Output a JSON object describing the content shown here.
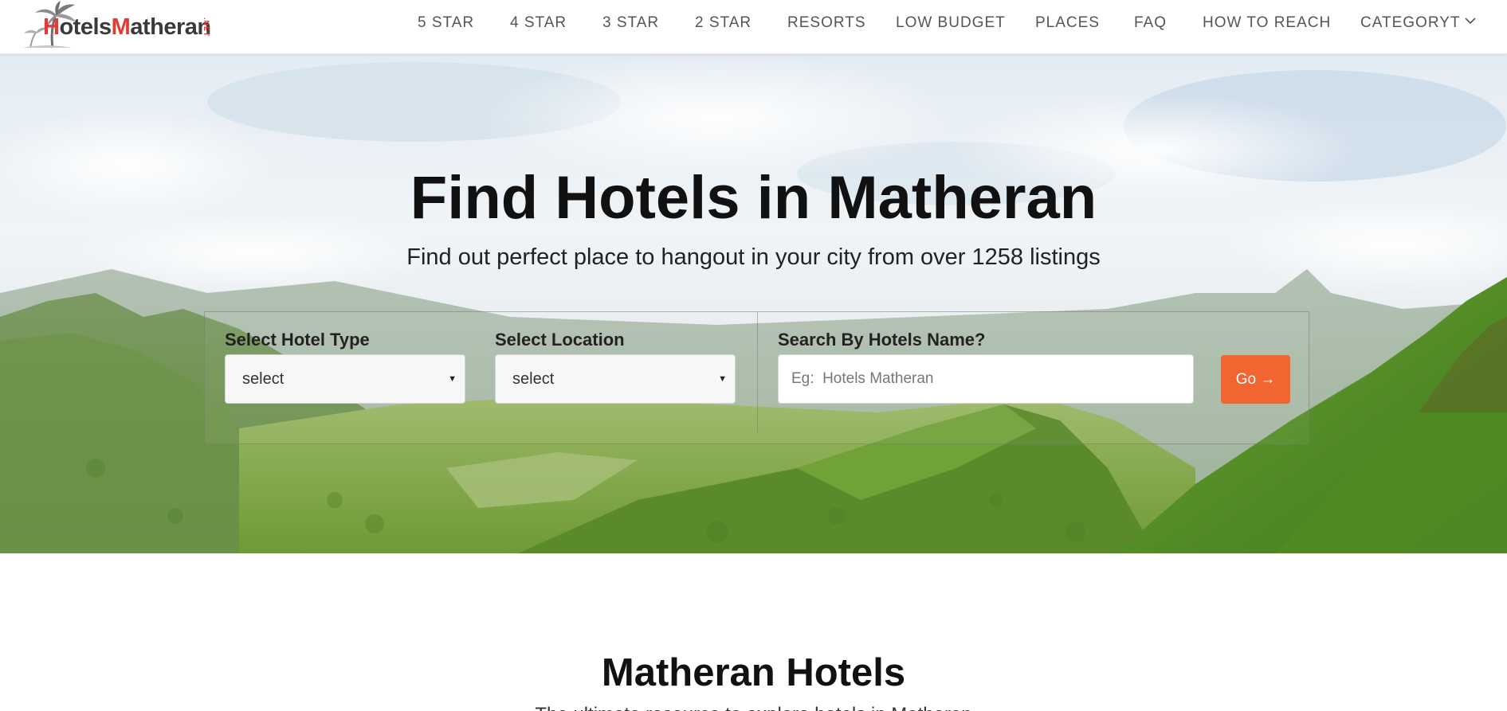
{
  "brand": {
    "logo_prefix": "H",
    "logo_part1": "otels",
    "logo_part2": "M",
    "logo_part3": "atheran",
    "logo_suffix": ".NET",
    "accent_color": "#e53935"
  },
  "nav": {
    "items": [
      {
        "label": "5 STAR"
      },
      {
        "label": "4 STAR"
      },
      {
        "label": "3 STAR"
      },
      {
        "label": "2 STAR"
      },
      {
        "label": "RESORTS"
      },
      {
        "label": "LOW BUDGET"
      },
      {
        "label": "PLACES"
      },
      {
        "label": "FAQ"
      },
      {
        "label": "HOW TO REACH"
      },
      {
        "label": "CATEGORYT",
        "icon": "chevron-down-icon"
      }
    ]
  },
  "hero": {
    "title": "Find Hotels in Matheran",
    "subtitle": "Find out perfect place to hangout in your city from over 1258 listings",
    "background": "mountain-valley-landscape"
  },
  "search": {
    "hotel_type_label": "Select Hotel Type",
    "hotel_type_value": "select",
    "location_label": "Select Location",
    "location_value": "select",
    "name_label": "Search By Hotels Name?",
    "name_placeholder": "Eg:  Hotels Matheran",
    "go_label": "Go →",
    "go_color": "#f26531"
  },
  "section": {
    "title": "Matheran Hotels",
    "description": "The ultimate resource to explore hotels in Matheran"
  }
}
